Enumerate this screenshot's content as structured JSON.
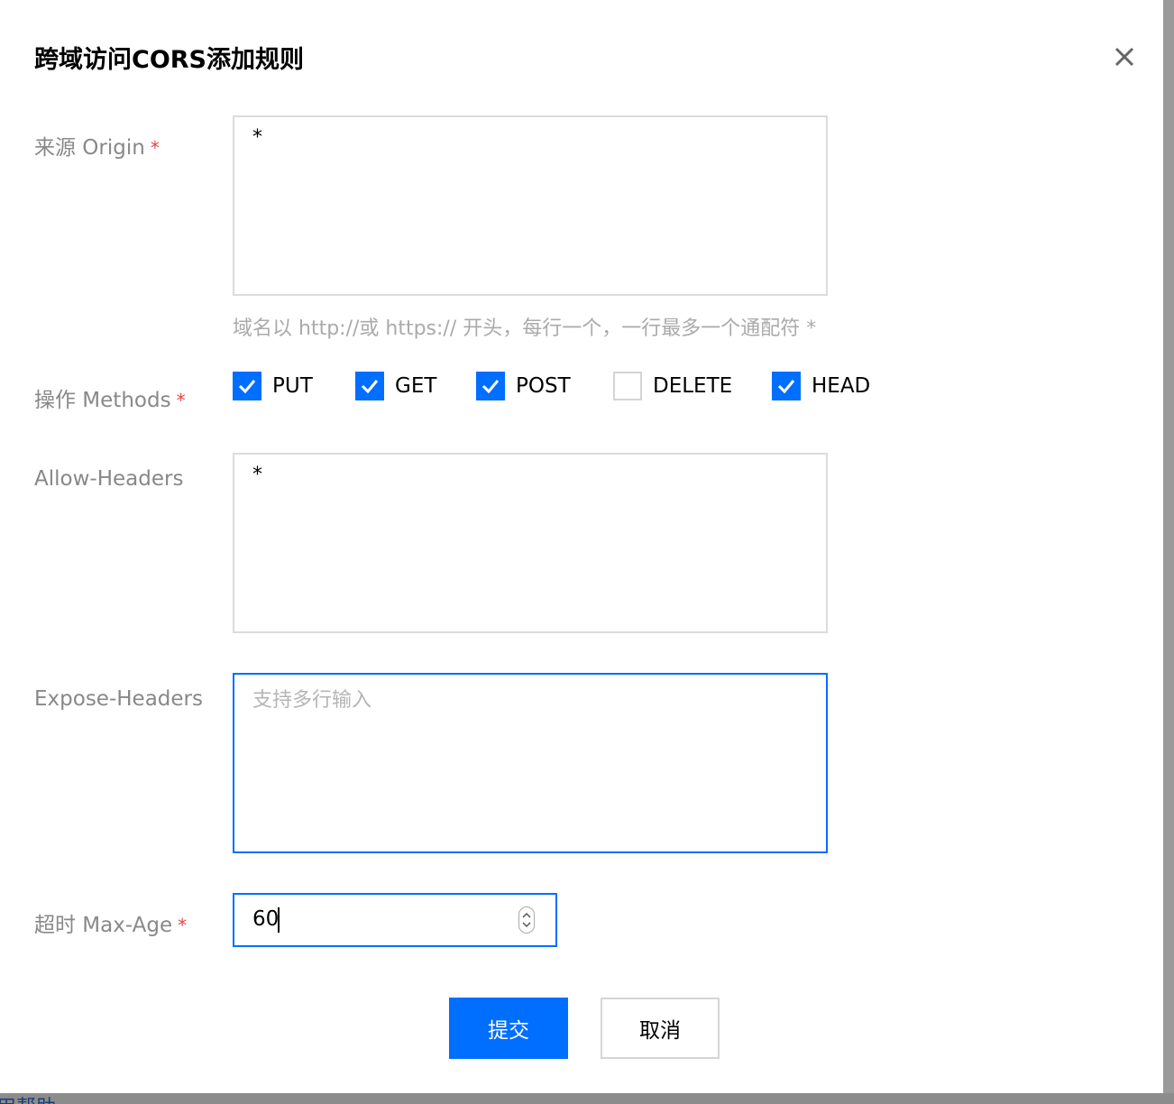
{
  "dialog": {
    "title": "跨域访问CORS添加规则",
    "close_icon": "close-icon"
  },
  "form": {
    "origin": {
      "label": "来源 Origin",
      "required_mark": "*",
      "value": "*",
      "hint": "域名以 http://或 https:// 开头，每行一个，一行最多一个通配符 *"
    },
    "methods": {
      "label": "操作 Methods",
      "required_mark": "*",
      "options": [
        {
          "label": "PUT",
          "checked": true
        },
        {
          "label": "GET",
          "checked": true
        },
        {
          "label": "POST",
          "checked": true
        },
        {
          "label": "DELETE",
          "checked": false
        },
        {
          "label": "HEAD",
          "checked": true
        }
      ]
    },
    "allow_headers": {
      "label": "Allow-Headers",
      "value": "*"
    },
    "expose_headers": {
      "label": "Expose-Headers",
      "value": "",
      "placeholder": "支持多行输入"
    },
    "max_age": {
      "label": "超时 Max-Age",
      "required_mark": "*",
      "value": "60"
    }
  },
  "actions": {
    "submit_label": "提交",
    "cancel_label": "取消"
  },
  "colors": {
    "primary": "#006eff",
    "required": "#e54545",
    "label": "#888888",
    "hint": "#aaaaaa"
  },
  "background": {
    "partial_text": "用帮助"
  }
}
